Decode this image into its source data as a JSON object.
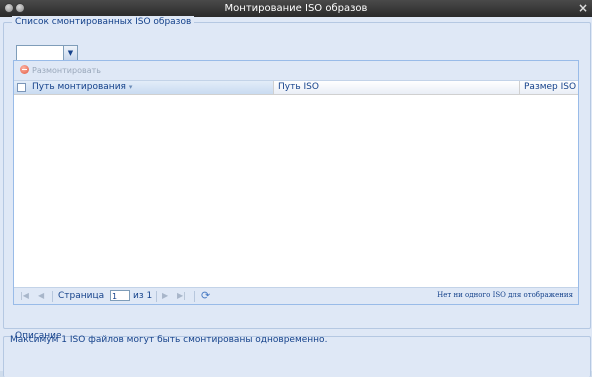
{
  "window": {
    "title": "Монтирование ISO образов",
    "close_glyph": "×"
  },
  "mounted_section": {
    "legend": "Список смонтированных ISO образов",
    "combo_value": ""
  },
  "toolbar": {
    "unmount_label": "Размонтировать",
    "unmount_icon": "remove-circle-icon"
  },
  "grid": {
    "columns": [
      {
        "label": "Путь монтирования",
        "sorted": true
      },
      {
        "label": "Путь ISO"
      },
      {
        "label": "Размер ISO"
      }
    ],
    "rows": []
  },
  "pager": {
    "page_label": "Страница",
    "page_value": "1",
    "of_label": "из 1",
    "empty_message": "Нет ни одного ISO для отображения"
  },
  "description": {
    "legend": "Описание",
    "text": "Максимум 1 ISO файлов могут быть смонтированы одновременно."
  }
}
